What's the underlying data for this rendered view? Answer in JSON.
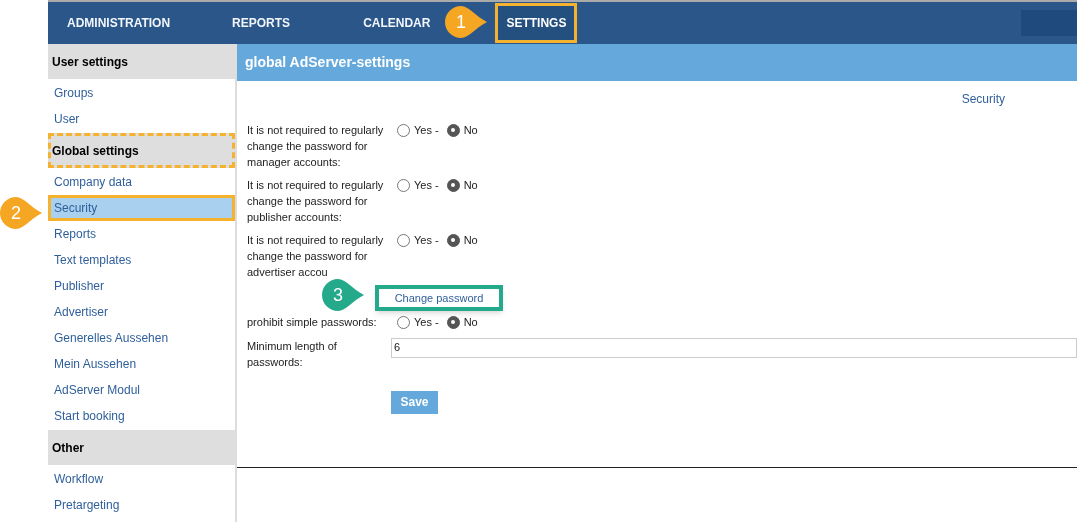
{
  "nav": [
    {
      "label": "ADMINISTRATION",
      "selected": false,
      "highlighted": false
    },
    {
      "label": "REPORTS",
      "selected": false,
      "highlighted": false
    },
    {
      "label": "CALENDAR",
      "selected": false,
      "highlighted": false
    },
    {
      "label": "SETTINGS",
      "selected": true,
      "highlighted": true
    }
  ],
  "sidebar": [
    {
      "title": "User settings",
      "highlighted": false,
      "items": [
        {
          "label": "Groups",
          "selected": false,
          "highlighted": false
        },
        {
          "label": "User",
          "selected": false,
          "highlighted": false
        }
      ]
    },
    {
      "title": "Global settings",
      "highlighted": true,
      "items": [
        {
          "label": "Company data",
          "selected": false,
          "highlighted": false
        },
        {
          "label": "Security",
          "selected": true,
          "highlighted": true
        },
        {
          "label": "Reports",
          "selected": false,
          "highlighted": false
        },
        {
          "label": "Text templates",
          "selected": false,
          "highlighted": false
        },
        {
          "label": "Publisher",
          "selected": false,
          "highlighted": false
        },
        {
          "label": "Advertiser",
          "selected": false,
          "highlighted": false
        },
        {
          "label": "Generelles Aussehen",
          "selected": false,
          "highlighted": false
        },
        {
          "label": "Mein Aussehen",
          "selected": false,
          "highlighted": false
        },
        {
          "label": "AdServer Modul",
          "selected": false,
          "highlighted": false
        },
        {
          "label": "Start booking",
          "selected": false,
          "highlighted": false
        }
      ]
    },
    {
      "title": "Other",
      "highlighted": false,
      "items": [
        {
          "label": "Workflow",
          "selected": false,
          "highlighted": false
        },
        {
          "label": "Pretargeting",
          "selected": false,
          "highlighted": false
        }
      ]
    }
  ],
  "page_title": "global AdServer-settings",
  "breadcrumb": "Security",
  "settings": [
    {
      "kind": "radio",
      "label": "It is not required to regularly change the password for manager accounts:",
      "options": [
        {
          "label": "Yes -",
          "selected": false
        },
        {
          "label": "No",
          "selected": true
        }
      ]
    },
    {
      "kind": "radio",
      "label": "It is not required to regularly change the password for publisher accounts:",
      "options": [
        {
          "label": "Yes -",
          "selected": false
        },
        {
          "label": "No",
          "selected": true
        }
      ]
    },
    {
      "kind": "radio",
      "label": "It is not required to regularly change the password for advertiser accou",
      "options": [
        {
          "label": "Yes -",
          "selected": false
        },
        {
          "label": "No",
          "selected": true
        }
      ]
    },
    {
      "kind": "button",
      "label": "Change password",
      "highlighted": true
    },
    {
      "kind": "radio",
      "label": "prohibit simple passwords:",
      "options": [
        {
          "label": "Yes -",
          "selected": false
        },
        {
          "label": "No",
          "selected": true
        }
      ]
    },
    {
      "kind": "input",
      "label": "Minimum length of passwords:",
      "value": "6"
    }
  ],
  "save_button": "Save",
  "callouts": [
    {
      "label": "1",
      "color": "#f5a623"
    },
    {
      "label": "2",
      "color": "#f5a623"
    },
    {
      "label": "3",
      "color": "#25a98b"
    }
  ]
}
